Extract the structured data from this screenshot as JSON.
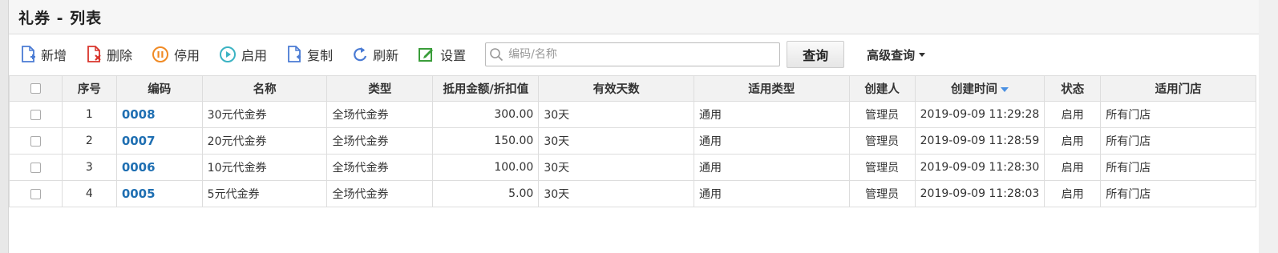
{
  "page_title": "礼券 - 列表",
  "toolbar": {
    "add": "新增",
    "delete": "删除",
    "disable": "停用",
    "enable": "启用",
    "copy": "复制",
    "refresh": "刷新",
    "settings": "设置",
    "search_placeholder": "编码/名称",
    "search_value": "",
    "query_button": "查询",
    "advanced_query": "高级查询"
  },
  "table": {
    "headers": [
      "序号",
      "编码",
      "名称",
      "类型",
      "抵用金额/折扣值",
      "有效天数",
      "适用类型",
      "创建人",
      "创建时间",
      "状态",
      "适用门店"
    ],
    "rows": [
      {
        "no": "1",
        "code": "0008",
        "name": "30元代金券",
        "type": "全场代金券",
        "amount": "300.00",
        "days": "30天",
        "apply_type": "通用",
        "creator": "管理员",
        "created": "2019-09-09 11:29:28",
        "status": "启用",
        "store": "所有门店"
      },
      {
        "no": "2",
        "code": "0007",
        "name": "20元代金券",
        "type": "全场代金券",
        "amount": "150.00",
        "days": "30天",
        "apply_type": "通用",
        "creator": "管理员",
        "created": "2019-09-09 11:28:59",
        "status": "启用",
        "store": "所有门店"
      },
      {
        "no": "3",
        "code": "0006",
        "name": "10元代金券",
        "type": "全场代金券",
        "amount": "100.00",
        "days": "30天",
        "apply_type": "通用",
        "creator": "管理员",
        "created": "2019-09-09 11:28:30",
        "status": "启用",
        "store": "所有门店"
      },
      {
        "no": "4",
        "code": "0005",
        "name": "5元代金券",
        "type": "全场代金券",
        "amount": "5.00",
        "days": "30天",
        "apply_type": "通用",
        "creator": "管理员",
        "created": "2019-09-09 11:28:03",
        "status": "启用",
        "store": "所有门店"
      }
    ]
  },
  "colors": {
    "code_link": "#1f6fb2",
    "add_icon": "#4a7bd4",
    "delete_icon": "#d9342b",
    "disable_icon": "#f08a24",
    "enable_icon": "#3bb3c3",
    "copy_icon": "#4a7bd4",
    "refresh_icon": "#4a7bd4",
    "settings_icon": "#3a9d3a",
    "sort_indicator": "#4a90e2"
  }
}
